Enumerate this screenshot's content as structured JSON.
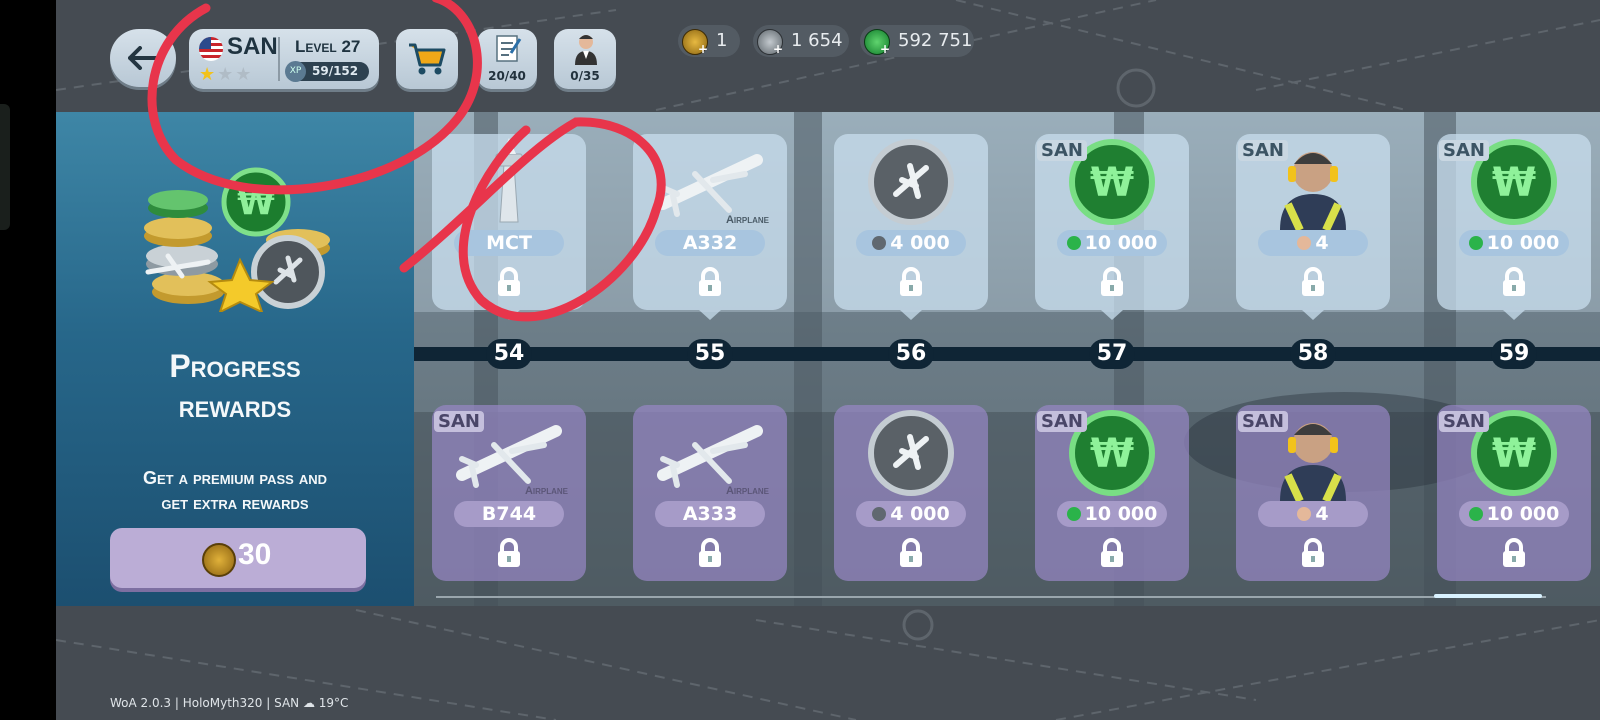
{
  "topbar": {
    "back_label": "←",
    "airport_code": "SAN",
    "level_label": "Level 27",
    "xp_badge": "XP",
    "xp": "59/152",
    "stars": {
      "filled": 1,
      "total": 3
    },
    "tasks_count": "20/40",
    "staff_count": "0/35"
  },
  "currencies": [
    {
      "name": "gold-plane-coin",
      "value": "1",
      "color": "#d9a520"
    },
    {
      "name": "silver-plane-coin",
      "value": "1 654",
      "color": "#9aa3aa"
    },
    {
      "name": "wings-coin",
      "value": "592 751",
      "color": "#2bb34a"
    }
  ],
  "panel": {
    "title_line1": "Progress",
    "title_line2": "rewards",
    "subtitle_line1": "Get a premium pass and",
    "subtitle_line2": "get extra rewards",
    "buy_price": "30"
  },
  "levels": [
    {
      "number": "54",
      "free": {
        "badge": "",
        "type": "tower",
        "tag": "",
        "label": "MCT",
        "locked": true
      },
      "premium": {
        "badge": "SAN",
        "type": "airplane",
        "tag": "Airplane",
        "label": "B744",
        "locked": true
      }
    },
    {
      "number": "55",
      "free": {
        "badge": "",
        "type": "airplane",
        "tag": "Airplane",
        "label": "A332",
        "locked": true
      },
      "premium": {
        "badge": "",
        "type": "airplane",
        "tag": "Airplane",
        "label": "A333",
        "locked": true
      }
    },
    {
      "number": "56",
      "free": {
        "badge": "",
        "type": "silver-coin",
        "tag": "",
        "label": "4 000",
        "locked": true
      },
      "premium": {
        "badge": "",
        "type": "silver-coin",
        "tag": "",
        "label": "4 000",
        "locked": true
      }
    },
    {
      "number": "57",
      "free": {
        "badge": "SAN",
        "type": "wings-coin",
        "tag": "",
        "label": "10 000",
        "locked": true
      },
      "premium": {
        "badge": "SAN",
        "type": "wings-coin",
        "tag": "",
        "label": "10 000",
        "locked": true
      }
    },
    {
      "number": "58",
      "free": {
        "badge": "SAN",
        "type": "staff",
        "tag": "",
        "label": "4",
        "locked": true
      },
      "premium": {
        "badge": "SAN",
        "type": "staff",
        "tag": "",
        "label": "4",
        "locked": true
      }
    },
    {
      "number": "59",
      "free": {
        "badge": "SAN",
        "type": "wings-coin",
        "tag": "",
        "label": "10 000",
        "locked": true
      },
      "premium": {
        "badge": "SAN",
        "type": "wings-coin",
        "tag": "",
        "label": "10 000",
        "locked": true
      }
    }
  ],
  "footer": "WoA 2.0.3 | HoloMyth320 | SAN ☁ 19°C",
  "colors": {
    "annotation_red": "#e8354b",
    "panel_blue": "#27678a",
    "premium_purple": "#9687c3"
  }
}
